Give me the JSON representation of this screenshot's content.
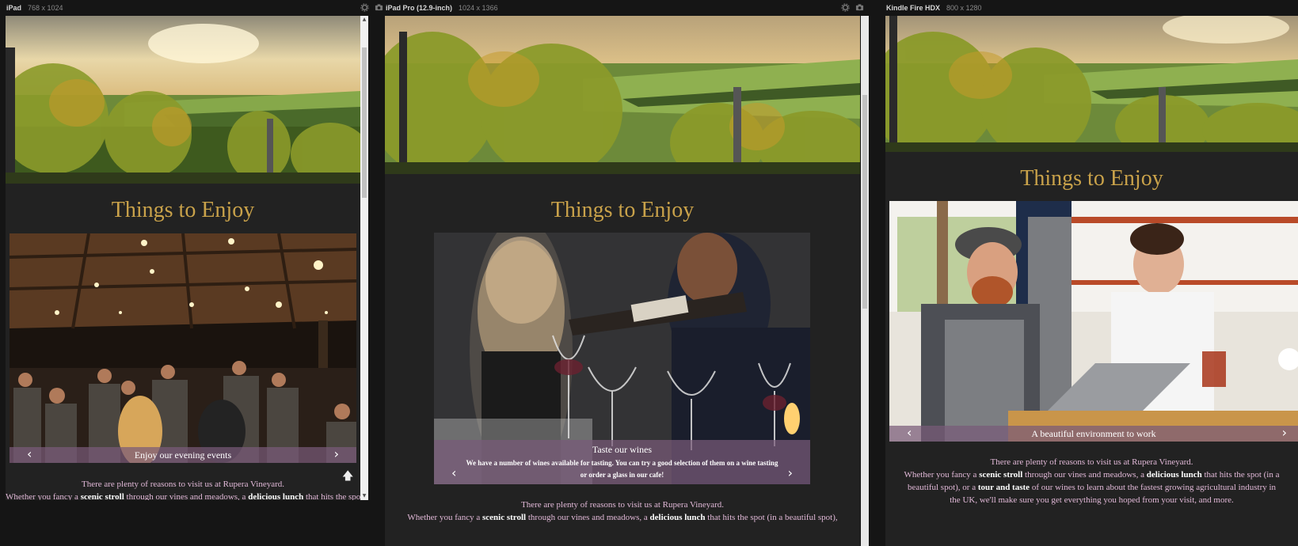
{
  "devices": [
    {
      "name": "iPad",
      "size": "768 x 1024"
    },
    {
      "name": "iPad Pro (12.9-inch)",
      "size": "1024 x 1366"
    },
    {
      "name": "Kindle Fire HDX",
      "size": "800 x 1280"
    }
  ],
  "page": {
    "heading": "Things to Enjoy",
    "intro": "There are plenty of reasons to visit us at Rupera Vineyard.",
    "para_a": "Whether you fancy a ",
    "scenic": "scenic stroll",
    "para_b": " through our vines and meadows, a ",
    "lunch": "delicious lunch",
    "para_c": " that hits the spot",
    "para_c_full": " that hits the spot (in a beautiful spot),",
    "para_c_kindle": " that hits the spot (in a",
    "kindle_line2a": "beautiful spot), or a ",
    "tour": "tour and taste",
    "kindle_line2b": " of our wines to learn about the fastest growing agricultural industry in",
    "kindle_line3": "the UK, we'll make sure you get everything you hoped from your visit, and more."
  },
  "slides": {
    "ipad": {
      "title": "Enjoy our evening events"
    },
    "ipadpro": {
      "title": "Taste our wines",
      "text": "We have a number of wines available for tasting. You can try a good selection of them on a wine tasting or order a glass in our cafe!"
    },
    "kindle": {
      "title": "A beautiful environment to work"
    }
  },
  "icons": {
    "prev": "‹",
    "next": "›",
    "up": "▲",
    "down": "▼",
    "to_top": "🡅"
  },
  "colors": {
    "heading": "#c9a24a",
    "caption_bg": "#7a5a7a",
    "body_text": "#e2b9d8",
    "frame_bg": "#222222"
  }
}
